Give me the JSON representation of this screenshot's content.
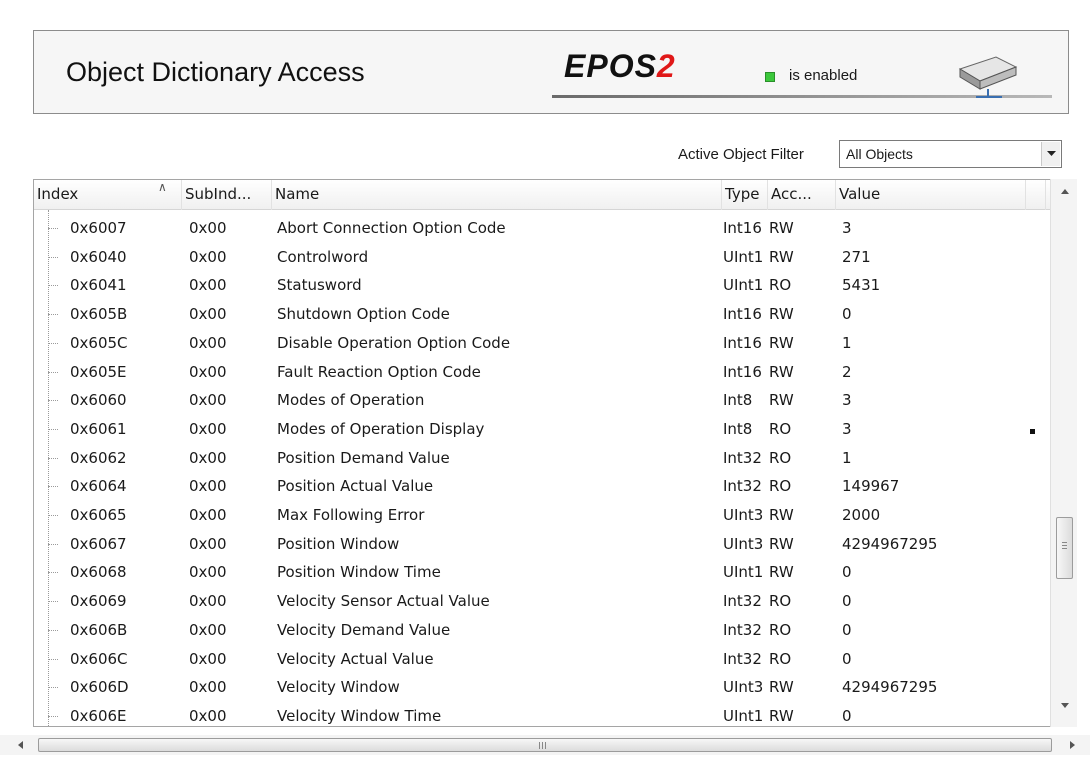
{
  "header": {
    "title": "Object Dictionary Access",
    "brand_text": "EPOS",
    "brand_number": "2",
    "status_text": "is enabled",
    "status_color": "#3cc83c",
    "device_icon": "device-icon"
  },
  "filter": {
    "label": "Active Object Filter",
    "value": "All Objects"
  },
  "table": {
    "columns": [
      "Index",
      "SubInd...",
      "Name",
      "Type",
      "Acc...",
      "Value"
    ],
    "rows": [
      {
        "index": "0x6007",
        "subindex": "0x00",
        "name": "Abort Connection Option Code",
        "type": "Int16",
        "access": "RW",
        "value": "3"
      },
      {
        "index": "0x6040",
        "subindex": "0x00",
        "name": "Controlword",
        "type": "UInt1",
        "access": "RW",
        "value": "271"
      },
      {
        "index": "0x6041",
        "subindex": "0x00",
        "name": "Statusword",
        "type": "UInt1",
        "access": "RO",
        "value": "5431"
      },
      {
        "index": "0x605B",
        "subindex": "0x00",
        "name": "Shutdown Option Code",
        "type": "Int16",
        "access": "RW",
        "value": "0"
      },
      {
        "index": "0x605C",
        "subindex": "0x00",
        "name": "Disable Operation Option Code",
        "type": "Int16",
        "access": "RW",
        "value": "1"
      },
      {
        "index": "0x605E",
        "subindex": "0x00",
        "name": "Fault Reaction Option Code",
        "type": "Int16",
        "access": "RW",
        "value": "2"
      },
      {
        "index": "0x6060",
        "subindex": "0x00",
        "name": "Modes of Operation",
        "type": "Int8",
        "access": "RW",
        "value": "3"
      },
      {
        "index": "0x6061",
        "subindex": "0x00",
        "name": "Modes of Operation Display",
        "type": "Int8",
        "access": "RO",
        "value": "3"
      },
      {
        "index": "0x6062",
        "subindex": "0x00",
        "name": "Position Demand Value",
        "type": "Int32",
        "access": "RO",
        "value": "1"
      },
      {
        "index": "0x6064",
        "subindex": "0x00",
        "name": "Position Actual Value",
        "type": "Int32",
        "access": "RO",
        "value": "149967"
      },
      {
        "index": "0x6065",
        "subindex": "0x00",
        "name": "Max Following Error",
        "type": "UInt3",
        "access": "RW",
        "value": "2000"
      },
      {
        "index": "0x6067",
        "subindex": "0x00",
        "name": "Position Window",
        "type": "UInt3",
        "access": "RW",
        "value": "4294967295"
      },
      {
        "index": "0x6068",
        "subindex": "0x00",
        "name": "Position Window Time",
        "type": "UInt1",
        "access": "RW",
        "value": "0"
      },
      {
        "index": "0x6069",
        "subindex": "0x00",
        "name": "Velocity Sensor Actual Value",
        "type": "Int32",
        "access": "RO",
        "value": "0"
      },
      {
        "index": "0x606B",
        "subindex": "0x00",
        "name": "Velocity Demand Value",
        "type": "Int32",
        "access": "RO",
        "value": "0"
      },
      {
        "index": "0x606C",
        "subindex": "0x00",
        "name": "Velocity Actual Value",
        "type": "Int32",
        "access": "RO",
        "value": "0"
      },
      {
        "index": "0x606D",
        "subindex": "0x00",
        "name": "Velocity Window",
        "type": "UInt3",
        "access": "RW",
        "value": "4294967295"
      },
      {
        "index": "0x606E",
        "subindex": "0x00",
        "name": "Velocity Window Time",
        "type": "UInt1",
        "access": "RW",
        "value": "0"
      }
    ]
  },
  "horizontal_scrollbar": {
    "grip_text": "III"
  }
}
